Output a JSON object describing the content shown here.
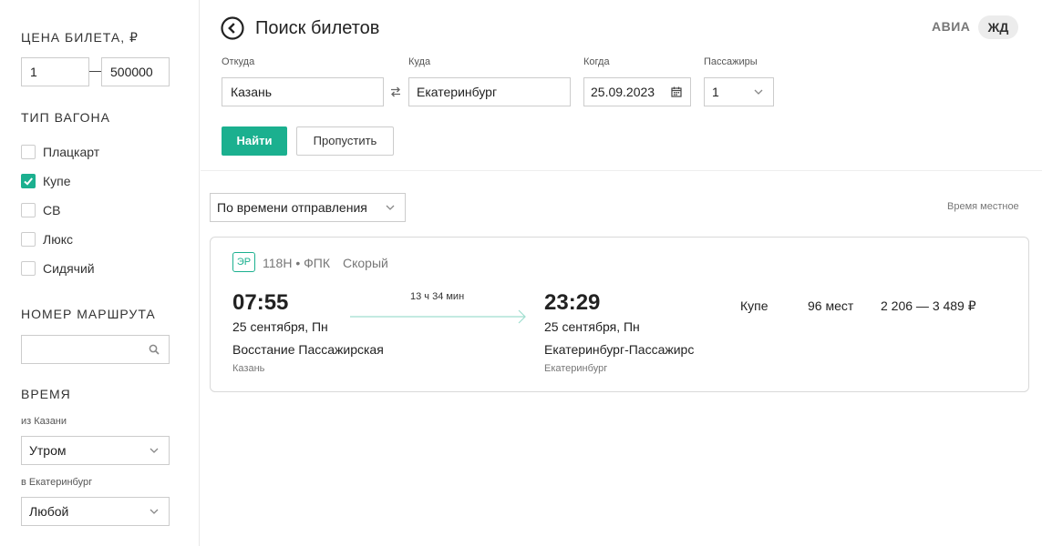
{
  "sidebar": {
    "price": {
      "title": "ЦЕНА БИЛЕТА, ₽",
      "min": "1",
      "max": "500000"
    },
    "car_type": {
      "title": "ТИП ВАГОНА",
      "options": [
        {
          "label": "Плацкарт",
          "checked": false
        },
        {
          "label": "Купе",
          "checked": true
        },
        {
          "label": "СВ",
          "checked": false
        },
        {
          "label": "Люкс",
          "checked": false
        },
        {
          "label": "Сидячий",
          "checked": false
        }
      ]
    },
    "route": {
      "title": "НОМЕР МАРШРУТА",
      "value": ""
    },
    "time": {
      "title": "ВРЕМЯ",
      "from_label": "из Казани",
      "from_value": "Утром",
      "to_label": "в Екатеринбург",
      "to_value": "Любой"
    }
  },
  "header": {
    "title": "Поиск билетов",
    "modes": [
      "АВИА",
      "ЖД"
    ],
    "active_mode": "ЖД"
  },
  "search": {
    "from_label": "Откуда",
    "from_value": "Казань",
    "to_label": "Куда",
    "to_value": "Екатеринбург",
    "date_label": "Когда",
    "date_value": "25.09.2023",
    "passengers_label": "Пассажиры",
    "passengers_value": "1",
    "find_button": "Найти",
    "skip_button": "Пропустить"
  },
  "results": {
    "sort_value": "По времени отправления",
    "local_time_note": "Время местное",
    "trips": [
      {
        "badge": "ЭР",
        "train": "118Н • ФПК",
        "train_type": "Скорый",
        "depart_time": "07:55",
        "depart_date": "25 сентября, Пн",
        "depart_station": "Восстание Пассажирская",
        "depart_city": "Казань",
        "duration": "13 ч 34 мин",
        "arrive_time": "23:29",
        "arrive_date": "25 сентября, Пн",
        "arrive_station": "Екатеринбург-Пассажирс",
        "arrive_city": "Екатеринбург",
        "car_class": "Купе",
        "seats": "96 мест",
        "price": "2 206 — 3 489 ₽"
      }
    ]
  },
  "colors": {
    "accent": "#1bb08f",
    "border": "#cccccc",
    "muted": "#777777"
  },
  "icons": [
    "back-arrow-icon",
    "swap-icon",
    "calendar-icon",
    "chevron-down-icon",
    "search-icon",
    "check-icon"
  ]
}
